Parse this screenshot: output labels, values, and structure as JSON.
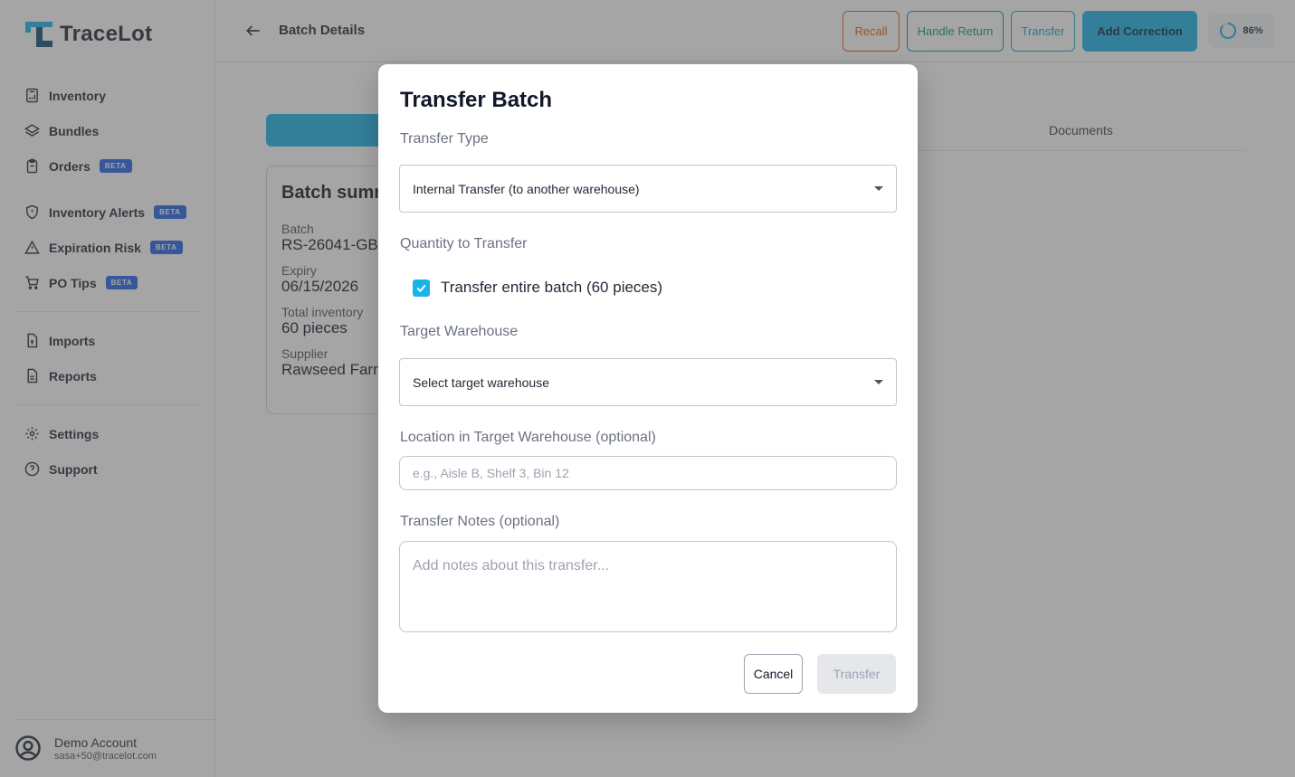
{
  "app": {
    "name": "TraceLot",
    "brand_color": "#1ab3e6"
  },
  "sidebar": {
    "groups": [
      [
        {
          "label": "Inventory",
          "icon": "calculator-icon",
          "beta": ""
        },
        {
          "label": "Bundles",
          "icon": "layers-icon",
          "beta": ""
        },
        {
          "label": "Orders",
          "icon": "clipboard-icon",
          "beta": "BETA"
        }
      ],
      [
        {
          "label": "Inventory Alerts",
          "icon": "shield-alert-icon",
          "beta": "BETA"
        },
        {
          "label": "Expiration Risk",
          "icon": "warning-triangle-icon",
          "beta": "BETA"
        },
        {
          "label": "PO Tips",
          "icon": "cart-icon",
          "beta": "BETA"
        }
      ],
      [
        {
          "label": "Imports",
          "icon": "file-import-icon",
          "beta": ""
        },
        {
          "label": "Reports",
          "icon": "file-report-icon",
          "beta": ""
        }
      ],
      [
        {
          "label": "Settings",
          "icon": "gear-icon",
          "beta": ""
        },
        {
          "label": "Support",
          "icon": "help-circle-icon",
          "beta": ""
        }
      ]
    ],
    "account": {
      "name": "Demo Account",
      "email": "sasa+50@tracelot.com"
    }
  },
  "header": {
    "title": "Batch Details",
    "buttons": {
      "recall": "Recall",
      "handle_return": "Handle Return",
      "transfer": "Transfer",
      "add_correction": "Add Correction"
    },
    "progress": {
      "label": "86%",
      "value": 0.86
    }
  },
  "background": {
    "tabs": {
      "documents": "Documents"
    },
    "summary": {
      "title": "Batch summary",
      "fields": [
        {
          "label": "Batch",
          "value": "RS-26041-GB"
        },
        {
          "label": "Expiry",
          "value": "06/15/2026"
        },
        {
          "label": "Total inventory",
          "value": "60 pieces"
        },
        {
          "label": "Supplier",
          "value": "Rawseed Farms"
        }
      ]
    }
  },
  "modal": {
    "title": "Transfer Batch",
    "transfer_type": {
      "label": "Transfer Type",
      "value": "Internal Transfer (to another warehouse)"
    },
    "quantity": {
      "label": "Quantity to Transfer",
      "checkbox_label": "Transfer entire batch (60 pieces)",
      "checked": true
    },
    "target_warehouse": {
      "label": "Target Warehouse",
      "value": "Select target warehouse"
    },
    "location": {
      "label": "Location in Target Warehouse (optional)",
      "placeholder": "e.g., Aisle B, Shelf 3, Bin 12"
    },
    "notes": {
      "label": "Transfer Notes (optional)",
      "placeholder": "Add notes about this transfer..."
    },
    "cancel_label": "Cancel",
    "submit_label": "Transfer"
  }
}
